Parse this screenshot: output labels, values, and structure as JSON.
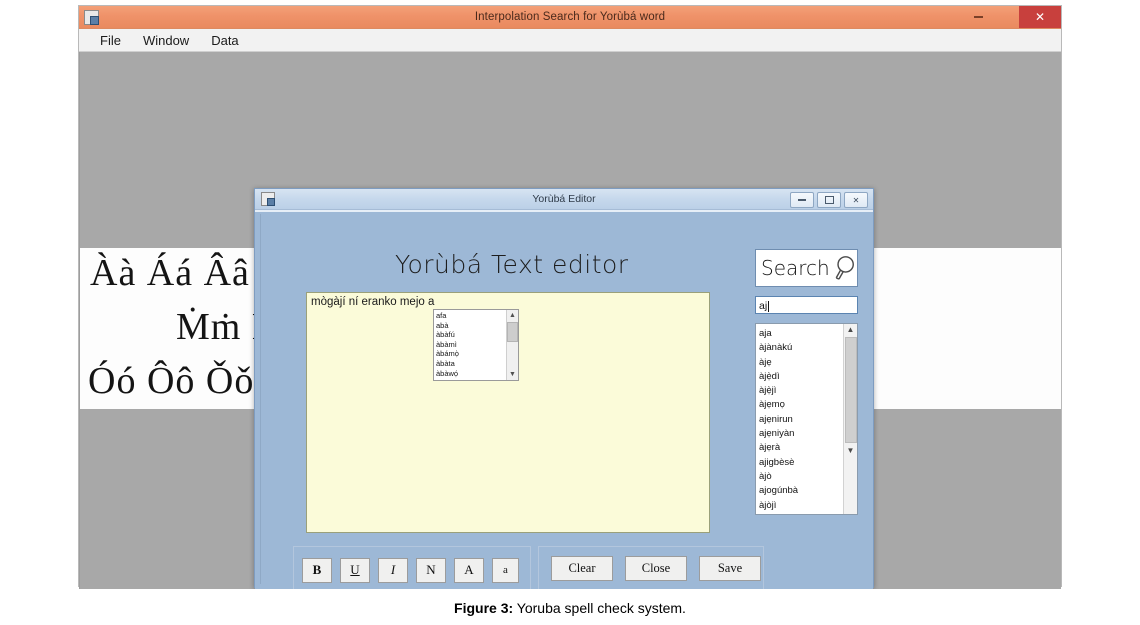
{
  "app": {
    "title": "Interpolation Search for Yorùbá  word",
    "icon": "app-form-icon",
    "menu": [
      "File",
      "Window",
      "Data"
    ],
    "window_controls": {
      "minimize": "minimize-icon",
      "restore": "restore-icon",
      "close": "✕"
    }
  },
  "charmap": {
    "row1": "Àà Áá Ââ Ǎǎ  Ẹẹ Ẹ́ẹ́ Ẹ̀ẹ̀  Ìì Íí Îî Ǐǐ",
    "row2": "Ṁṁ Ḿḿ  Ǹǹ Ńń  Ọọ Ọ̀ọ̀",
    "row3": "Óó Ôô Ǒǒ  Òò Õõ  Õõ Ọ̃ọ̃ Ũũ"
  },
  "editor": {
    "title": "Yorùbá  Editor",
    "icon": "form-icon",
    "heading": "Yorùbá  Text editor",
    "window_controls": {
      "minimize": "minimize-icon",
      "maximize": "maximize-icon",
      "close": "✕"
    },
    "document": {
      "text": "mògàjí ní eranko mejo a"
    },
    "suggestions": {
      "items": [
        "afa",
        "abà",
        "àbàfú",
        "àbàmì",
        "àbámọ̀",
        "àbàta",
        "àbàwọ́"
      ],
      "scroll_up": "▲",
      "scroll_down": "▼"
    },
    "search": {
      "label": "Search",
      "icon": "magnifier-icon",
      "value": "aj",
      "placeholder": ""
    },
    "results": {
      "items": [
        "aja",
        "àjànàkú",
        "àjẹ",
        "àjẹ̀dì",
        "àjẹ̀jì",
        "àjẹmọ",
        "ajẹnirun",
        "ajẹniyàn",
        "àjẹrà",
        "ajigbèsè",
        "àjò",
        "ajogúnbà",
        "àjòjì"
      ],
      "scroll_up": "▲",
      "scroll_down": "▼"
    },
    "format_buttons": [
      {
        "label": "B",
        "name": "bold-button"
      },
      {
        "label": "U",
        "name": "underline-button"
      },
      {
        "label": "I",
        "name": "italic-button"
      },
      {
        "label": "N",
        "name": "normal-button"
      },
      {
        "label": "A",
        "name": "uppercase-button"
      },
      {
        "label": "a",
        "name": "lowercase-button"
      }
    ],
    "actions": [
      {
        "label": "Clear",
        "name": "clear-button"
      },
      {
        "label": "Close",
        "name": "close-button"
      },
      {
        "label": "Save",
        "name": "save-button"
      }
    ]
  },
  "figure": {
    "number": "Figure 3:",
    "caption": " Yoruba spell check system."
  },
  "colors": {
    "title_bar": "#ef9269",
    "close_button": "#c8403d",
    "desktop": "#a8a8a8",
    "dialog": "#9db8d6",
    "document": "#fbfbd9"
  }
}
